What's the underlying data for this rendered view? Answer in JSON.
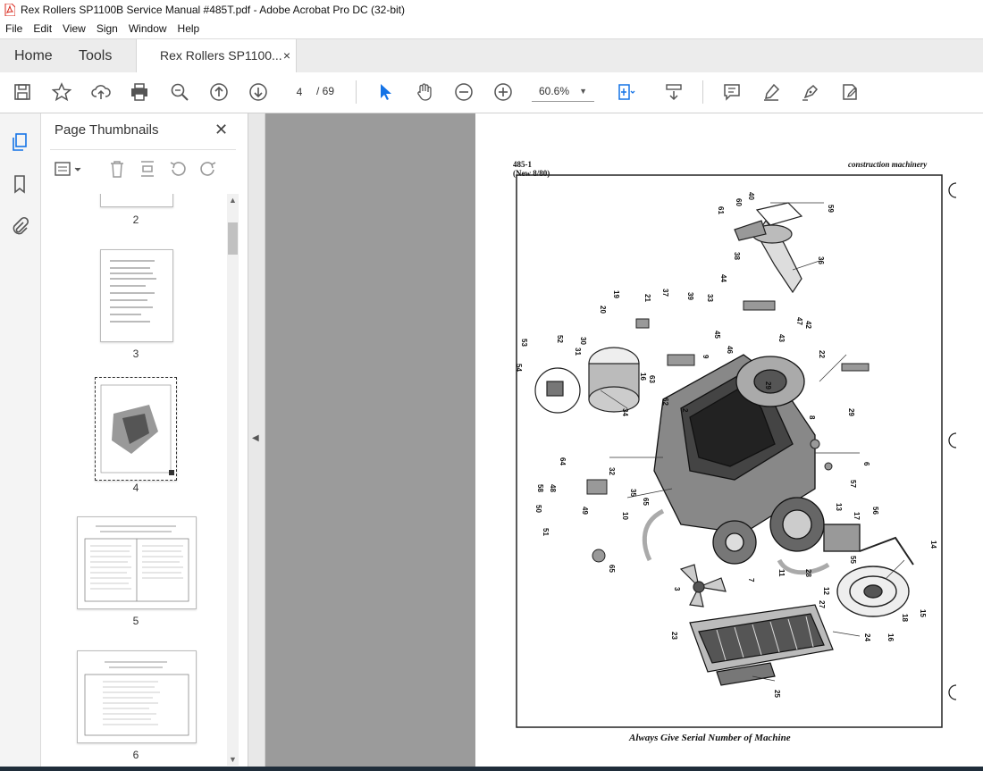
{
  "window": {
    "title": "Rex Rollers SP1100B Service Manual #485T.pdf - Adobe Acrobat Pro DC (32-bit)"
  },
  "menu": [
    "File",
    "Edit",
    "View",
    "Sign",
    "Window",
    "Help"
  ],
  "tabs": {
    "home": "Home",
    "tools": "Tools",
    "document": "Rex Rollers SP1100...",
    "close": "×"
  },
  "toolbar": {
    "current_page": "4",
    "page_separator": "/  69",
    "zoom": "60.6%",
    "zoom_arrow": "▼"
  },
  "thumbnails_panel": {
    "title": "Page Thumbnails",
    "close": "✕",
    "pages": [
      "2",
      "3",
      "4",
      "5",
      "6"
    ],
    "selected_page": "4"
  },
  "document_page": {
    "header_left_1": "485-1",
    "header_left_2": "(New 8/80)",
    "header_right": "construction machinery",
    "footer": "Always Give Serial Number of Machine",
    "callouts": [
      "59",
      "40",
      "60",
      "61",
      "38",
      "36",
      "44",
      "19",
      "21",
      "37",
      "41",
      "39",
      "33",
      "20",
      "47",
      "42",
      "45",
      "43",
      "46",
      "53",
      "52",
      "31",
      "30",
      "54",
      "9",
      "22",
      "8",
      "2",
      "58",
      "16",
      "63",
      "34",
      "62",
      "29",
      "1",
      "6",
      "64",
      "32",
      "57",
      "58",
      "48",
      "35",
      "65",
      "50",
      "51",
      "10",
      "49",
      "13",
      "17",
      "56",
      "55",
      "65",
      "3",
      "7",
      "11",
      "28",
      "12",
      "27",
      "14",
      "18",
      "15",
      "16",
      "23",
      "24",
      "25",
      "5",
      "26"
    ]
  },
  "colors": {
    "viewer_bg": "#9b9b9b",
    "tabbar_bg": "#ececec",
    "accent_blue": "#1473e6",
    "icon_gray": "#555555"
  }
}
